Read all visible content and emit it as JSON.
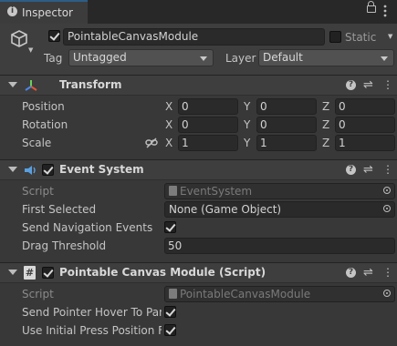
{
  "tab": {
    "title": "Inspector"
  },
  "gameobject": {
    "active": true,
    "name": "PointableCanvasModule",
    "static_label": "Static",
    "static_checked": false,
    "tag_label": "Tag",
    "tag_value": "Untagged",
    "layer_label": "Layer",
    "layer_value": "Default"
  },
  "transform": {
    "title": "Transform",
    "rows": [
      {
        "label": "Position",
        "x": "0",
        "y": "0",
        "z": "0"
      },
      {
        "label": "Rotation",
        "x": "0",
        "y": "0",
        "z": "0"
      },
      {
        "label": "Scale",
        "x": "1",
        "y": "1",
        "z": "1"
      }
    ],
    "axes": {
      "x": "X",
      "y": "Y",
      "z": "Z"
    }
  },
  "event_system": {
    "title": "Event System",
    "enabled": true,
    "script_label": "Script",
    "script_value": "EventSystem",
    "first_selected_label": "First Selected",
    "first_selected_value": "None (Game Object)",
    "send_nav_label": "Send Navigation Events",
    "send_nav_checked": true,
    "drag_threshold_label": "Drag Threshold",
    "drag_threshold_value": "50"
  },
  "pointable_module": {
    "title": "Pointable Canvas Module (Script)",
    "enabled": true,
    "script_label": "Script",
    "script_value": "PointableCanvasModule",
    "hover_label": "Send Pointer Hover To Parent",
    "hover_checked": true,
    "initial_press_label": "Use Initial Press Position For Drag",
    "initial_press_checked": true
  },
  "colors": {
    "background": "#383838",
    "header": "#3e3e3e",
    "field": "#2a2a2a",
    "tab_accent": "#2c5d87"
  },
  "icons": [
    "info-icon",
    "lock-icon",
    "kebab-icon",
    "gameobject-cube-icon",
    "transform-axes-icon",
    "event-system-icon",
    "script-hash-icon",
    "help-icon",
    "preset-icon",
    "component-menu-icon",
    "link-scale-icon",
    "target-icon"
  ]
}
